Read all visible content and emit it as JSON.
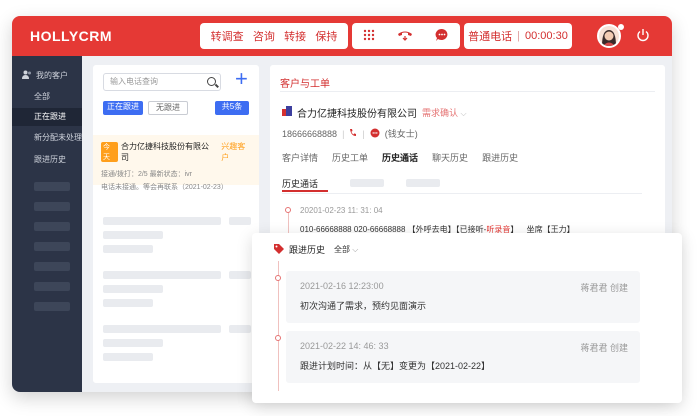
{
  "brand": {
    "name": "HOLLYCRM"
  },
  "topbar": {
    "actions": [
      "转调查",
      "咨询",
      "转接",
      "保持"
    ],
    "phone_status": "普通电话",
    "timer": "00:00:30",
    "icons": [
      "grid-icon",
      "hangup-icon",
      "chat-icon",
      "power-icon"
    ]
  },
  "sidebar": {
    "title": "我的客户",
    "items": [
      {
        "label": "全部"
      },
      {
        "label": "正在跟进",
        "active": true
      },
      {
        "label": "新分配未处理"
      },
      {
        "label": "跟进历史"
      }
    ]
  },
  "list": {
    "search_placeholder": "输入电话查询",
    "filters": [
      "正在跟进",
      "无跟进"
    ],
    "count_label": "共5条",
    "card": {
      "tag": "今天",
      "company": "合力亿捷科技股份有限公司",
      "status": "兴趣客户",
      "line1": "接通/拨打：2/5  最新状态：ivr",
      "line2": "电话未接通。等会再联系（2021-02-23）"
    }
  },
  "detail": {
    "section_title": "客户与工单",
    "company": "合力亿捷科技股份有限公司",
    "need_label": "需求确认",
    "phone": "18666668888",
    "contact": "(钱女士)",
    "tabs": [
      "客户详情",
      "历史工单",
      "历史通话",
      "聊天历史",
      "跟进历史"
    ],
    "active_tab": "历史通话",
    "subtab": "历史通话",
    "call": {
      "time": "20201-02-23 11: 31: 04",
      "numbers": "010-66668888  020-66668888",
      "type": "【外呼去电】",
      "status_prefix": "【已接听-",
      "recording": "听录音",
      "status_suffix": "】",
      "agent": "坐席【王力】"
    }
  },
  "followup": {
    "title": "跟进历史",
    "filter_label": "全部",
    "entries": [
      {
        "time": "2021-02-16 12:23:00",
        "author": "蒋君君 创建",
        "text": "初次沟通了需求，预约见面演示"
      },
      {
        "time": "2021-02-22 14: 46: 33",
        "author": "蒋君君 创建",
        "text": "跟进计划时间：从【无】变更为【2021-02-22】"
      }
    ]
  },
  "colors": {
    "primary_red": "#e53935",
    "sidebar_bg": "#2c3447",
    "accent_blue": "#3d6df2",
    "tag_orange": "#ff9f1c"
  }
}
